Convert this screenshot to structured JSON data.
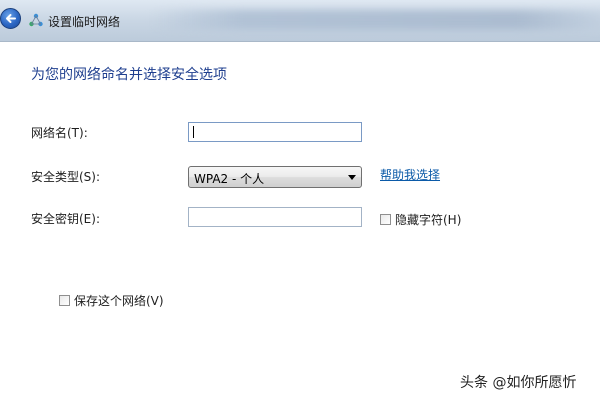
{
  "window": {
    "title": "设置临时网络",
    "background_blurred_text": "",
    "accent_color": "#2c67c4"
  },
  "page": {
    "heading": "为您的网络命名并选择安全选项"
  },
  "form": {
    "network_name": {
      "label": "网络名(T):",
      "value": "",
      "placeholder": ""
    },
    "security_type": {
      "label": "安全类型(S):",
      "selected": "WPA2 - 个人"
    },
    "help_link": "帮助我选择",
    "security_key": {
      "label": "安全密钥(E):",
      "value": "",
      "placeholder": ""
    },
    "hide_chars": {
      "label": "隐藏字符(H)",
      "checked": false
    },
    "save_network": {
      "label": "保存这个网络(V)",
      "checked": false
    }
  },
  "watermark": {
    "text": "头条 @如你所愿忻"
  },
  "icons": {
    "back": "back-arrow-icon",
    "network": "adhoc-network-icon",
    "dropdown": "chevron-down-icon"
  }
}
